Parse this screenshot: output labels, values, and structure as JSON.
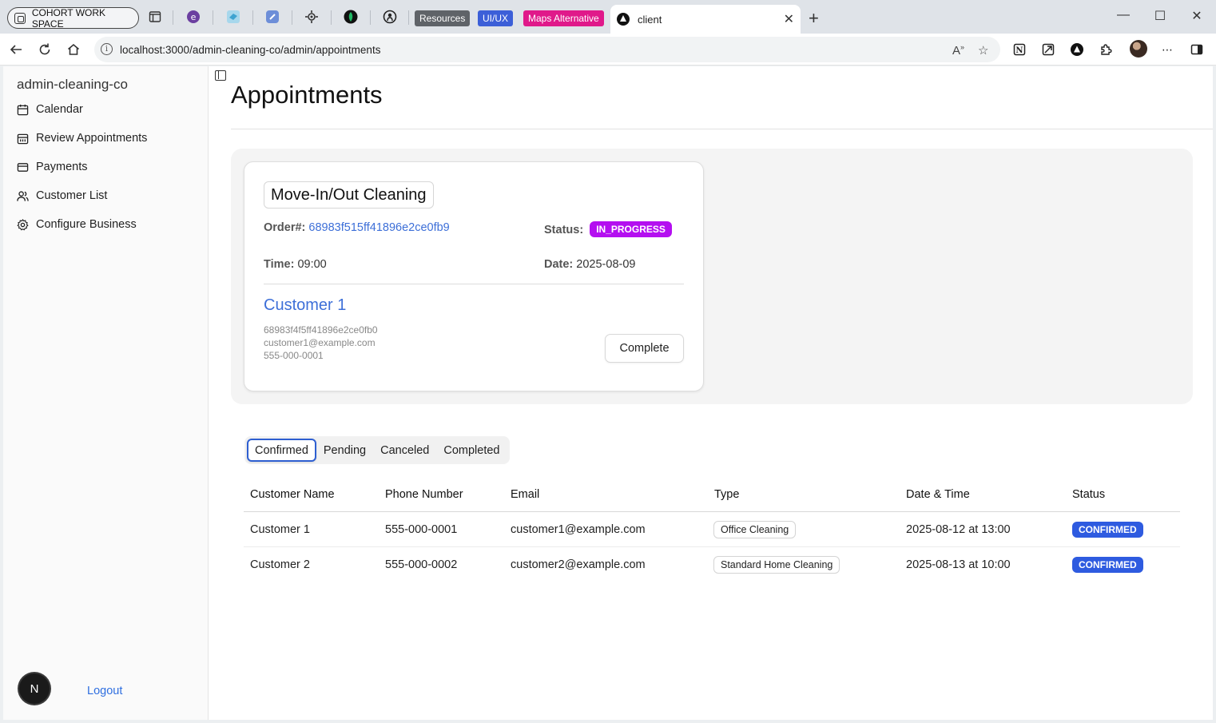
{
  "browser": {
    "workspace_label": "COHORT WORK SPACE",
    "pills": [
      {
        "label": "Resources",
        "color": "#5f6368"
      },
      {
        "label": "UI/UX",
        "color": "#3c5fd8"
      },
      {
        "label": "Maps Alternative",
        "color": "#e0198a"
      }
    ],
    "active_tab_title": "client",
    "url": "localhost:3000/admin-cleaning-co/admin/appointments"
  },
  "sidebar": {
    "brand": "admin-cleaning-co",
    "items": [
      {
        "label": "Calendar",
        "icon": "calendar-icon"
      },
      {
        "label": "Review Appointments",
        "icon": "calendar-check-icon"
      },
      {
        "label": "Payments",
        "icon": "credit-card-icon"
      },
      {
        "label": "Customer List",
        "icon": "users-icon"
      },
      {
        "label": "Configure Business",
        "icon": "gear-icon"
      }
    ],
    "next_badge": "N",
    "logout": "Logout"
  },
  "main": {
    "title": "Appointments",
    "current": {
      "service": "Move-In/Out Cleaning",
      "order_label": "Order#:",
      "order_id": "68983f515ff41896e2ce0fb9",
      "status_label": "Status:",
      "status": "IN_PROGRESS",
      "time_label": "Time:",
      "time": "09:00",
      "date_label": "Date:",
      "date": "2025-08-09",
      "customer_name": "Customer 1",
      "customer_id": "68983f4f5ff41896e2ce0fb0",
      "customer_email": "customer1@example.com",
      "customer_phone": "555-000-0001",
      "complete_button": "Complete"
    },
    "tabs": [
      "Confirmed",
      "Pending",
      "Canceled",
      "Completed"
    ],
    "table": {
      "columns": [
        "Customer Name",
        "Phone Number",
        "Email",
        "Type",
        "Date & Time",
        "Status"
      ],
      "rows": [
        {
          "name": "Customer 1",
          "phone": "555-000-0001",
          "email": "customer1@example.com",
          "type": "Office Cleaning",
          "datetime": "2025-08-12 at 13:00",
          "status": "CONFIRMED"
        },
        {
          "name": "Customer 2",
          "phone": "555-000-0002",
          "email": "customer2@example.com",
          "type": "Standard Home Cleaning",
          "datetime": "2025-08-13 at 10:00",
          "status": "CONFIRMED"
        }
      ]
    }
  },
  "colors": {
    "accent": "#2e5be0",
    "link": "#3d6fd8",
    "in_progress": "#b40ff0"
  }
}
